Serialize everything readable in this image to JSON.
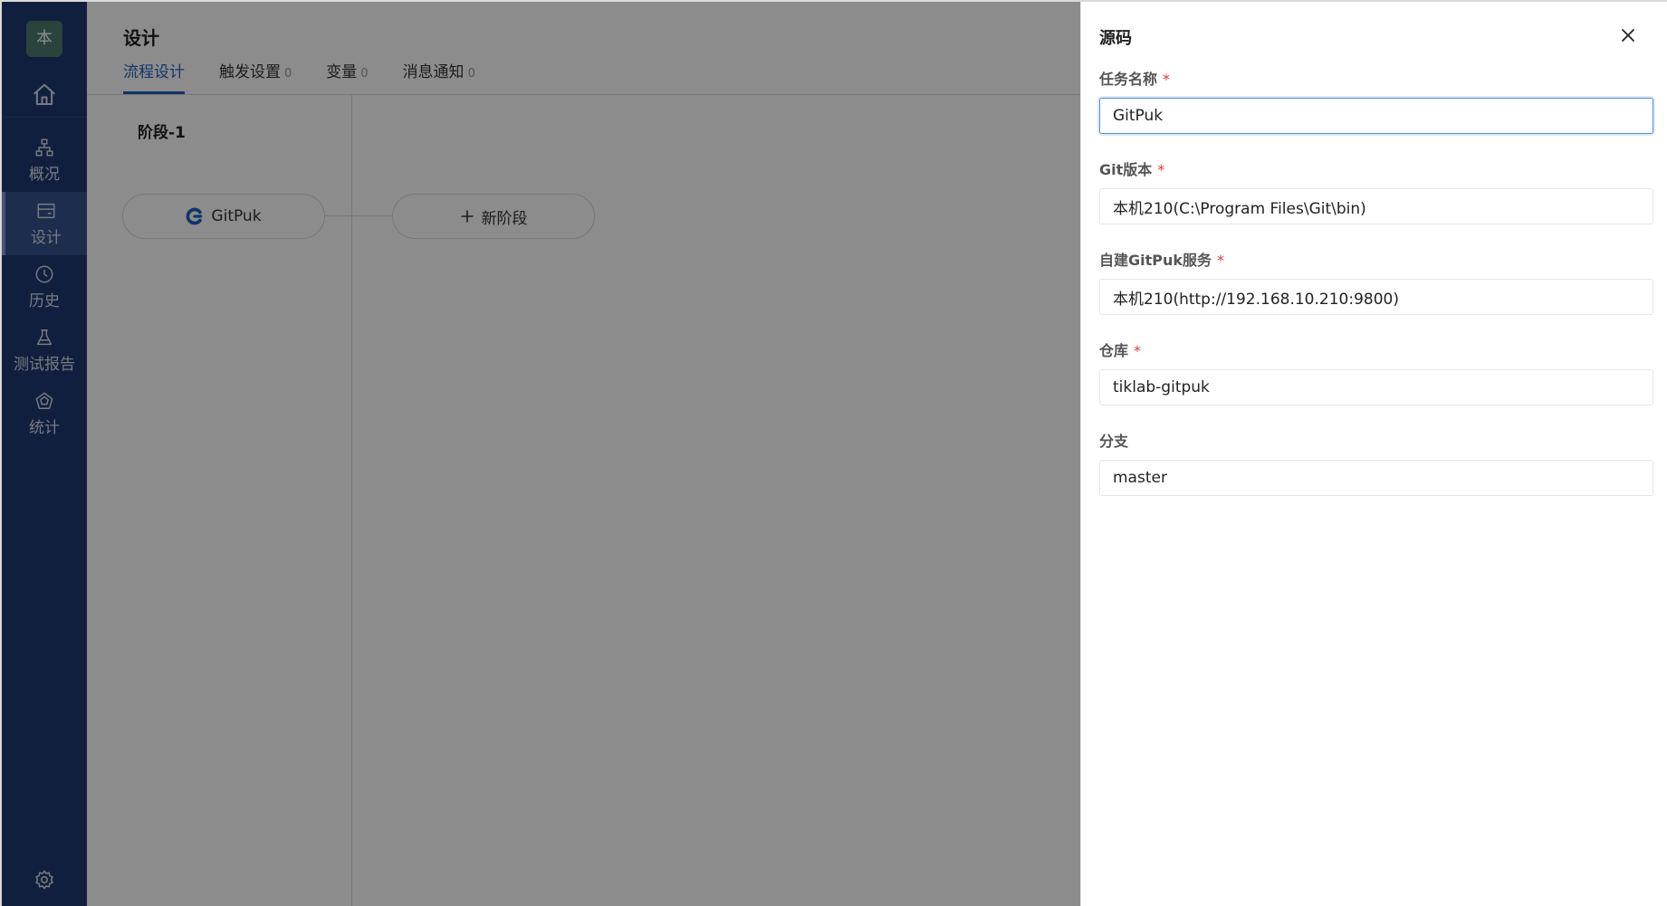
{
  "sidebar": {
    "avatar": "本",
    "items": [
      {
        "label": "概况",
        "icon": "overview-icon"
      },
      {
        "label": "设计",
        "icon": "design-icon",
        "active": true
      },
      {
        "label": "历史",
        "icon": "history-icon"
      },
      {
        "label": "测试报告",
        "icon": "test-report-icon"
      },
      {
        "label": "统计",
        "icon": "statistics-icon"
      }
    ]
  },
  "main": {
    "title": "设计",
    "tabs": [
      {
        "label": "流程设计",
        "count": ""
      },
      {
        "label": "触发设置",
        "count": "0"
      },
      {
        "label": "变量",
        "count": "0"
      },
      {
        "label": "消息通知",
        "count": "0"
      }
    ],
    "stage": {
      "title": "阶段-1",
      "task_label": "GitPuk",
      "new_stage_label": "新阶段"
    }
  },
  "drawer": {
    "title": "源码",
    "fields": [
      {
        "label": "任务名称",
        "required": true,
        "value": "GitPuk"
      },
      {
        "label": "Git版本",
        "required": true,
        "value": "本机210(C:\\Program Files\\Git\\bin)"
      },
      {
        "label": "自建GitPuk服务",
        "required": true,
        "value": "本机210(http://192.168.10.210:9800)"
      },
      {
        "label": "仓库",
        "required": true,
        "value": "tiklab-gitpuk"
      },
      {
        "label": "分支",
        "required": false,
        "value": "master"
      }
    ]
  },
  "colors": {
    "sidebar_bg": "#1f3a73",
    "accent": "#1f5fbf",
    "required": "#e53935"
  }
}
